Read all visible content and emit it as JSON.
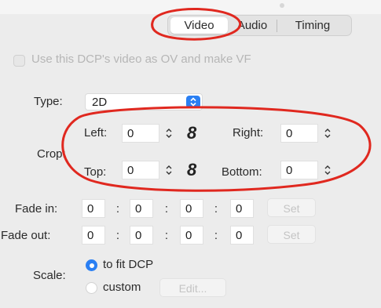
{
  "tabs": {
    "video": "Video",
    "audio": "Audio",
    "timing": "Timing"
  },
  "ov_checkbox": {
    "label": "Use this DCP's video as OV and make VF",
    "checked": false
  },
  "type": {
    "label": "Type:",
    "value": "2D"
  },
  "crop": {
    "label": "Crop:",
    "left_label": "Left:",
    "left_value": "0",
    "right_label": "Right:",
    "right_value": "0",
    "top_label": "Top:",
    "top_value": "0",
    "bottom_label": "Bottom:",
    "bottom_value": "0"
  },
  "fade_in": {
    "label": "Fade in:",
    "h": "0",
    "m": "0",
    "s": "0",
    "f": "0",
    "sep": ":",
    "set_label": "Set"
  },
  "fade_out": {
    "label": "Fade out:",
    "h": "0",
    "m": "0",
    "s": "0",
    "f": "0",
    "sep": ":",
    "set_label": "Set"
  },
  "scale": {
    "label": "Scale:",
    "fit_label": "to fit DCP",
    "custom_label": "custom",
    "edit_label": "Edit...",
    "selected": "fit"
  },
  "colors": {
    "accent": "#2a7ff3",
    "annotation": "#e0281f",
    "background": "#ececec"
  },
  "icons": {
    "link": "chain-link-icon",
    "stepper": "up-down-stepper-icon",
    "select": "chevron-up-down-icon"
  }
}
